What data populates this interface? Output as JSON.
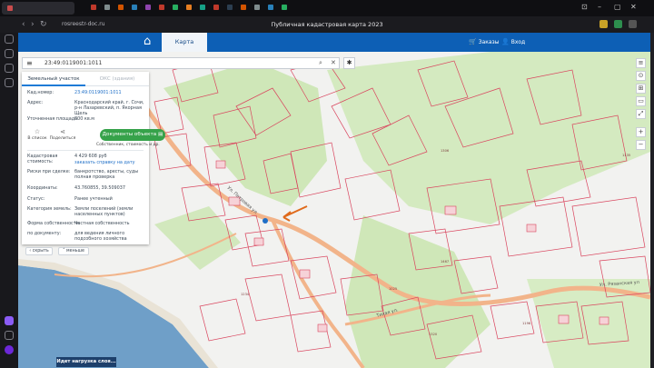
{
  "browser": {
    "url": "rosreestr-doc.ru",
    "page_title": "Публичная кадастровая карта 2023"
  },
  "header": {
    "map_tab": "Карта",
    "orders": "Заказы",
    "login": "Вход"
  },
  "search": {
    "query": "23:49:0119001:1011"
  },
  "panel": {
    "tabs": [
      "Земельный участок",
      "ОКС (здания)"
    ],
    "cad_number_label": "Кад.номер:",
    "cad_number_value": "23:49:0119001:1011",
    "address_label": "Адрес:",
    "address_value": "Краснодарский край, г. Сочи, р-н Лазаревский, п. Якорная Щель",
    "area_label": "Уточненная площадь:",
    "area_value": "800 кв.м",
    "actions": {
      "save": "В список",
      "share": "Поделиться",
      "docs_button": "Документы объекта",
      "docs_sub": "Собственник, стоимость и др."
    },
    "value_label": "Кадастровая стоимость:",
    "value_value": "4 429 608 руб",
    "value_link": "заказать справку на дату",
    "risks_label": "Риски при сделке:",
    "risks_value": "банкротство, аресты, суды полная проверка",
    "coords_label": "Координаты:",
    "coords_value": "43.760855, 39.509037",
    "status_label": "Статус:",
    "status_value": "Ранее учтенный",
    "category_label": "Категория земель:",
    "category_value": "Земли поселений (земли населенных пунктов)",
    "ownership_label": "Форма собственности:",
    "ownership_value": "Частная собственность",
    "use_label": "по документу:",
    "use_value": "для ведения личного подсобного хозяйства",
    "hide": "скрыть",
    "less": "меньше"
  },
  "map": {
    "streets": [
      "Ул. Петровая ул",
      "Тихая ул.",
      "Ул. Рязанская ул"
    ],
    "plot_labels": [
      "1135",
      "1306",
      "1467",
      "1320",
      "1234",
      "1025",
      "1196"
    ],
    "loading": "Идет нагрузка слоя..."
  },
  "colors": {
    "header": "#0d5fb5",
    "docs_button": "#36a24a",
    "parcel_border": "#d9455e",
    "green_zone": "#cfe7b8",
    "water": "#6f9fc8",
    "road": "#f2b48a"
  }
}
